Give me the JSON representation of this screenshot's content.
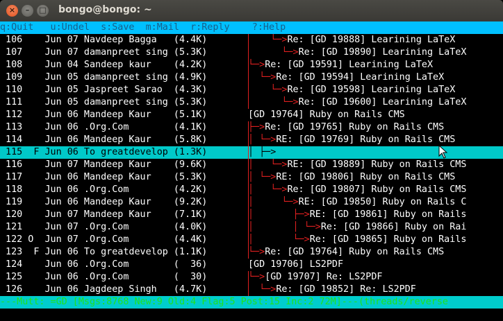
{
  "window": {
    "title": "bongo@bongo: ~"
  },
  "help_bar": "q:Quit   u:Undel  s:Save  m:Mail  r:Reply    ?:Help",
  "messages": [
    {
      "n": " 106",
      "flag": "  ",
      "date": "Jun 07",
      "from": "Navdeep Bagga  ",
      "size": "(4.4K)",
      "tree": "    └─>",
      "subject": "Re: [GD 19888] Learining LaTeX"
    },
    {
      "n": " 107",
      "flag": "  ",
      "date": "Jun 07",
      "from": "damanpreet sing",
      "size": "(5.3K)",
      "tree": "      └─>",
      "subject": "Re: [GD 19890] Learining LaTeX"
    },
    {
      "n": " 108",
      "flag": "  ",
      "date": "Jun 04",
      "from": "Sandeep kaur   ",
      "size": "(4.2K)",
      "tree": "└─>",
      "subject": "Re: [GD 19591] Learining LaTeX"
    },
    {
      "n": " 109",
      "flag": "  ",
      "date": "Jun 05",
      "from": "damanpreet sing",
      "size": "(4.9K)",
      "tree": "  └─>",
      "subject": "Re: [GD 19594] Learining LaTeX"
    },
    {
      "n": " 110",
      "flag": "  ",
      "date": "Jun 05",
      "from": "Jaspreet Sarao ",
      "size": "(4.3K)",
      "tree": "    └─>",
      "subject": "Re: [GD 19598] Learining LaTeX"
    },
    {
      "n": " 111",
      "flag": "  ",
      "date": "Jun 05",
      "from": "damanpreet sing",
      "size": "(5.3K)",
      "tree": "      └─>",
      "subject": "Re: [GD 19600] Learining LaTeX"
    },
    {
      "n": " 112",
      "flag": "  ",
      "date": "Jun 06",
      "from": "Mandeep Kaur   ",
      "size": "(5.1K)",
      "tree": "",
      "subject": "[GD 19764] Ruby on Rails CMS"
    },
    {
      "n": " 113",
      "flag": "  ",
      "date": "Jun 06",
      "from": ".Org.Com       ",
      "size": "(4.1K)",
      "tree": "├─>",
      "subject": "Re: [GD 19765] Ruby on Rails CMS"
    },
    {
      "n": " 114",
      "flag": "  ",
      "date": "Jun 06",
      "from": "Mandeep Kaur   ",
      "size": "(5.8K)",
      "tree": "│ └─>",
      "subject": "RE: [GD 19769] Ruby on Rails CMS"
    },
    {
      "n": " 115",
      "flag": " F",
      "date": "Jun 06",
      "from": "To greatdevelop",
      "size": "(1.3K)",
      "tree": "│ ├─>",
      "subject": ""
    },
    {
      "n": " 116",
      "flag": "  ",
      "date": "Jun 07",
      "from": "Mandeep Kaur   ",
      "size": "(9.6K)",
      "tree": "│   └─>",
      "subject": "RE: [GD 19889] Ruby on Rails CMS"
    },
    {
      "n": " 117",
      "flag": "  ",
      "date": "Jun 06",
      "from": "Mandeep Kaur   ",
      "size": "(5.3K)",
      "tree": "│ └─>",
      "subject": "RE: [GD 19806] Ruby on Rails CMS"
    },
    {
      "n": " 118",
      "flag": "  ",
      "date": "Jun 06",
      "from": ".Org.Com       ",
      "size": "(4.2K)",
      "tree": "│   └─>",
      "subject": "Re: [GD 19807] Ruby on Rails CMS"
    },
    {
      "n": " 119",
      "flag": "  ",
      "date": "Jun 06",
      "from": "Mandeep Kaur   ",
      "size": "(9.2K)",
      "tree": "│     └─>",
      "subject": "RE: [GD 19850] Ruby on Rails C"
    },
    {
      "n": " 120",
      "flag": "  ",
      "date": "Jun 07",
      "from": "Mandeep Kaur   ",
      "size": "(7.1K)",
      "tree": "│       ├─>",
      "subject": "RE: [GD 19861] Ruby on Rails"
    },
    {
      "n": " 121",
      "flag": "  ",
      "date": "Jun 07",
      "from": ".Org.Com       ",
      "size": "(4.0K)",
      "tree": "│       │ └─>",
      "subject": "Re: [GD 19866] Ruby on Rai"
    },
    {
      "n": " 122",
      "flag": "O ",
      "date": "Jun 07",
      "from": ".Org.Com       ",
      "size": "(4.4K)",
      "tree": "│       └─>",
      "subject": "Re: [GD 19865] Ruby on Rails"
    },
    {
      "n": " 123",
      "flag": " F",
      "date": "Jun 06",
      "from": "To greatdevelop",
      "size": "(1.1K)",
      "tree": "└─>",
      "subject": "Re: [GD 19764] Ruby on Rails CMS"
    },
    {
      "n": " 124",
      "flag": "  ",
      "date": "Jun 06",
      "from": ".Org.Com       ",
      "size": "(  36)",
      "tree": "",
      "subject": "[GD 19706] LS2PDF"
    },
    {
      "n": " 125",
      "flag": "  ",
      "date": "Jun 06",
      "from": ".Org.Com       ",
      "size": "(  30)",
      "tree": "└─>",
      "subject": "[GD 19707] Re: LS2PDF"
    },
    {
      "n": " 126",
      "flag": "  ",
      "date": "Jun 06",
      "from": "Jagdeep Singh  ",
      "size": "(4.7K)",
      "tree": "  └─>",
      "subject": "Re: [GD 19852] Re: LS2PDF"
    }
  ],
  "selected_index": 9,
  "status_bar": "---Mutt: =GD [Msgs:8768 New:9 Old:4 Flag:5 Post:15 Inc:2 72M]---(threads/reverse"
}
